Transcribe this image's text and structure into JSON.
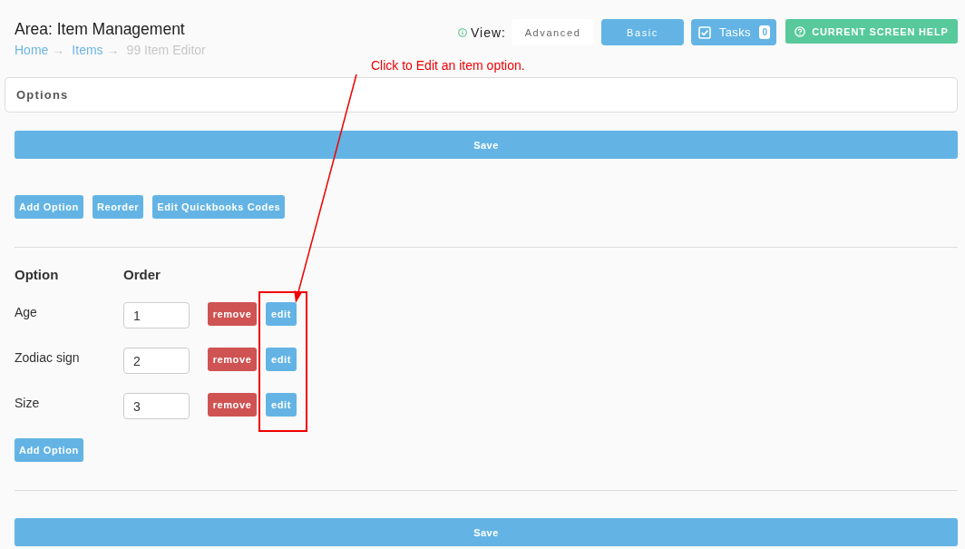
{
  "header": {
    "area_title": "Area: Item Management",
    "breadcrumb": [
      {
        "label": "Home",
        "current": false,
        "separator": "→"
      },
      {
        "label": "Items",
        "current": false,
        "separator": "→"
      },
      {
        "label": "99 Item Editor",
        "current": true
      }
    ],
    "view": {
      "label": "View:",
      "options": [
        {
          "label": "Advanced",
          "selected": false
        },
        {
          "label": "Basic",
          "selected": true
        }
      ]
    },
    "tasks": {
      "label": "Tasks",
      "count": "0"
    },
    "help_button": {
      "label": "CURRENT SCREEN HELP"
    }
  },
  "annotation": {
    "text": "Click to Edit an item option."
  },
  "panel": {
    "title": "Options"
  },
  "save_top": {
    "label": "Save"
  },
  "toolbar": [
    {
      "label": "Add Option"
    },
    {
      "label": "Reorder"
    },
    {
      "label": "Edit Quickbooks Codes"
    }
  ],
  "table": {
    "columns": [
      "Option",
      "Order"
    ],
    "rows": [
      {
        "name": "Age",
        "order": "1",
        "remove": "remove",
        "edit": "edit"
      },
      {
        "name": "Zodiac sign",
        "order": "2",
        "remove": "remove",
        "edit": "edit"
      },
      {
        "name": "Size",
        "order": "3",
        "remove": "remove",
        "edit": "edit"
      }
    ]
  },
  "add_option_bottom": {
    "label": "Add Option"
  },
  "save_bottom": {
    "label": "Save"
  }
}
